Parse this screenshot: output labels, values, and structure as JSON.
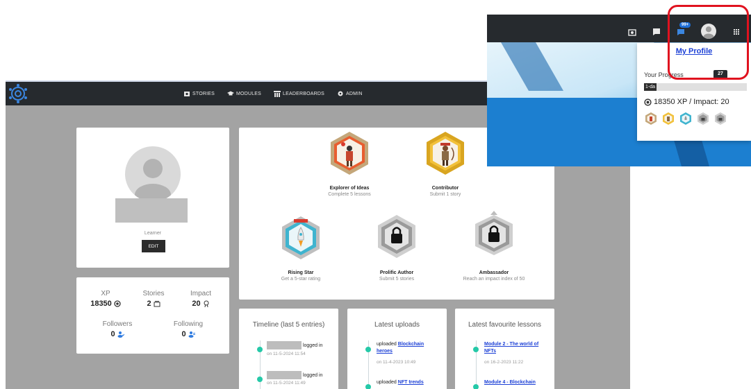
{
  "nav": {
    "items": [
      {
        "label": "STORIES",
        "icon": "story-icon"
      },
      {
        "label": "MODULES",
        "icon": "graduation-cap-icon"
      },
      {
        "label": "LEADERBOARDS",
        "icon": "leaderboard-icon"
      },
      {
        "label": "ADMIN",
        "icon": "admin-gear-icon"
      }
    ],
    "notification_count": "99+"
  },
  "profile": {
    "role": "Learner",
    "edit_label": "EDIT"
  },
  "stats": {
    "xp_label": "XP",
    "xp_value": "18350",
    "stories_label": "Stories",
    "stories_value": "2",
    "impact_label": "Impact",
    "impact_value": "20",
    "followers_label": "Followers",
    "followers_value": "0",
    "following_label": "Following",
    "following_value": "0"
  },
  "achievements": [
    {
      "title": "Explorer of Ideas",
      "subtitle": "Complete 5 lessons",
      "locked": false
    },
    {
      "title": "Contributor",
      "subtitle": "Submit 1 story",
      "locked": false
    },
    {
      "title": "Rising Star",
      "subtitle": "Get a 5-star rating",
      "locked": false
    },
    {
      "title": "Prolific Author",
      "subtitle": "Submit 5 stories",
      "locked": true
    },
    {
      "title": "Ambassador",
      "subtitle": "Reach an impact index of 50",
      "locked": true
    }
  ],
  "timeline": {
    "title": "Timeline (last 5 entries)",
    "entries": [
      {
        "action": "logged in",
        "date": "on 11-5-2024 11:54"
      },
      {
        "action": "logged in",
        "date": "on 11-5-2024 11:49"
      }
    ]
  },
  "uploads": {
    "title": "Latest uploads",
    "entries": [
      {
        "prefix": "uploaded",
        "link": "Blockchain heroes",
        "date": "on 11-4-2023 10:49"
      },
      {
        "prefix": "uploaded",
        "link": "NFT trends",
        "date": ""
      }
    ]
  },
  "favourites": {
    "title": "Latest favourite lessons",
    "entries": [
      {
        "link": "Module 2 - The world of NFTs",
        "date": "on 16-2-2023 11:22"
      },
      {
        "link": "Module 4 - Blockchain",
        "date": ""
      }
    ]
  },
  "dropdown": {
    "my_profile": "My Profile",
    "progress_label": "Your Progress",
    "progress_count": "27",
    "progress_bar_text": "1-da",
    "progress_fraction": 0.12,
    "xp_impact": "18350 XP / Impact: 20"
  },
  "colors": {
    "topbar": "#262a2e",
    "background": "#a3a3a3",
    "accent_link": "#1b3fd6",
    "timeline_dot": "#25c9a8",
    "highlight": "#e0121f",
    "badge": "#1f6fd8"
  }
}
